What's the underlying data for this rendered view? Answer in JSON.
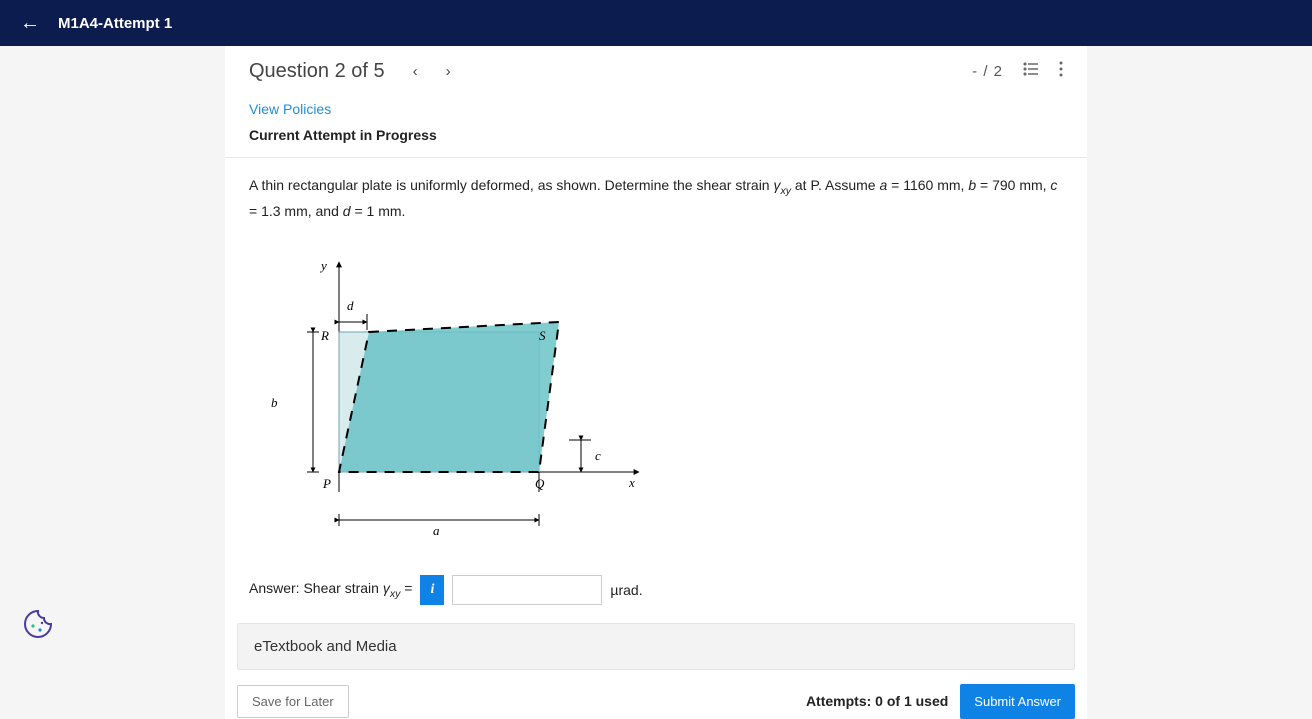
{
  "header": {
    "title": "M1A4-Attempt 1"
  },
  "question_bar": {
    "title": "Question 2 of 5",
    "score": "- / 2"
  },
  "policies_link": "View Policies",
  "attempt_status": "Current Attempt in Progress",
  "problem": {
    "text_pre": "A thin rectangular plate is uniformly deformed, as shown. Determine the shear strain ",
    "symbol_main": "γ",
    "symbol_sub": "xy",
    "text_mid": " at P. Assume ",
    "a_label": "a",
    "a_val": " = 1160 mm, ",
    "b_label": "b",
    "b_val": " = 790 mm, ",
    "c_label": "c",
    "c_val": " = 1.3 mm, and ",
    "d_label": "d",
    "d_val": " = 1 mm."
  },
  "diagram": {
    "y": "y",
    "x": "x",
    "d": "d",
    "R": "R",
    "S": "S",
    "b": "b",
    "c": "c",
    "P": "P",
    "Q": "Q",
    "a": "a"
  },
  "answer": {
    "label_pre": "Answer: Shear strain ",
    "symbol_main": "γ",
    "symbol_sub": "xy",
    "equals": " = ",
    "info": "i",
    "unit": "µrad."
  },
  "resource_bar": "eTextbook and Media",
  "footer": {
    "save": "Save for Later",
    "attempts": "Attempts: 0 of 1 used",
    "submit": "Submit Answer"
  }
}
